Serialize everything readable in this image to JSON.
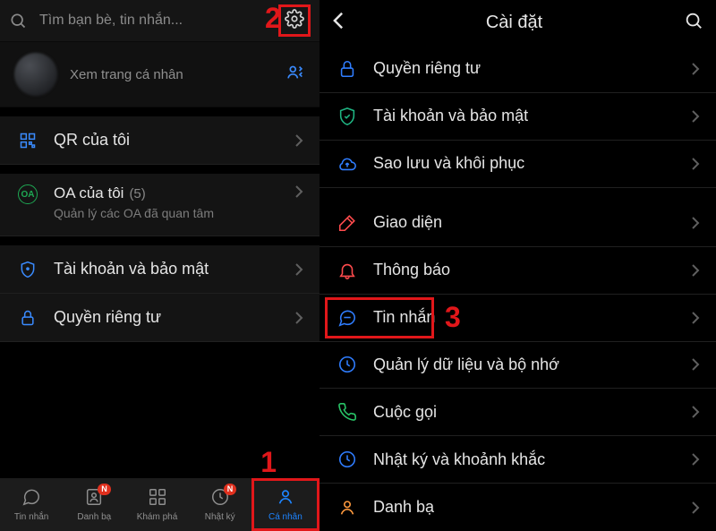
{
  "callouts": {
    "1": "1",
    "2": "2",
    "3": "3"
  },
  "left": {
    "search_placeholder": "Tìm bạn bè, tin nhắn...",
    "profile_sub": "Xem trang cá nhân",
    "qr": "QR của tôi",
    "oa_title": "OA của tôi",
    "oa_count": "(5)",
    "oa_sub": "Quản lý các OA đã quan tâm",
    "security": "Tài khoản và bảo mật",
    "privacy": "Quyền riêng tư",
    "tabs": {
      "messages": "Tin nhắn",
      "contacts": "Danh bạ",
      "discover": "Khám phá",
      "diary": "Nhật ký",
      "me": "Cá nhân",
      "badge": "N"
    }
  },
  "right": {
    "title": "Cài đặt",
    "items": {
      "privacy": "Quyền riêng tư",
      "security": "Tài khoản và bảo mật",
      "backup": "Sao lưu và khôi phục",
      "theme": "Giao diện",
      "notif": "Thông báo",
      "messages": "Tin nhắn",
      "data": "Quản lý dữ liệu và bộ nhớ",
      "calls": "Cuộc gọi",
      "diary": "Nhật ký và khoảnh khắc",
      "contacts": "Danh bạ"
    }
  }
}
